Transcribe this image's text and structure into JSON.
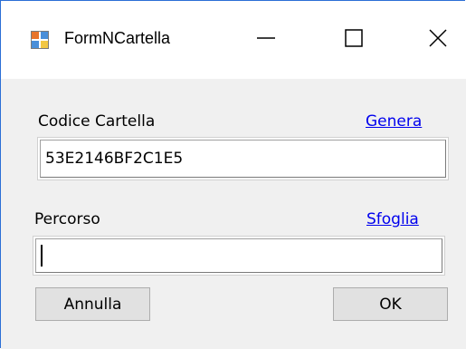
{
  "window": {
    "title": "FormNCartella"
  },
  "titlebar_buttons": {
    "minimize_icon": "minimize-icon",
    "maximize_icon": "maximize-icon",
    "close_icon": "close-icon"
  },
  "form": {
    "codice_label": "Codice Cartella",
    "genera_link": "Genera",
    "codice_value": "53E2146BF2C1E5",
    "percorso_label": "Percorso",
    "sfoglia_link": "Sfoglia",
    "percorso_value": ""
  },
  "buttons": {
    "annulla_label": "Annulla",
    "ok_label": "OK"
  },
  "colors": {
    "window_border": "#2b6fd6",
    "link": "#0000ee",
    "client_bg": "#f0f0f0"
  }
}
